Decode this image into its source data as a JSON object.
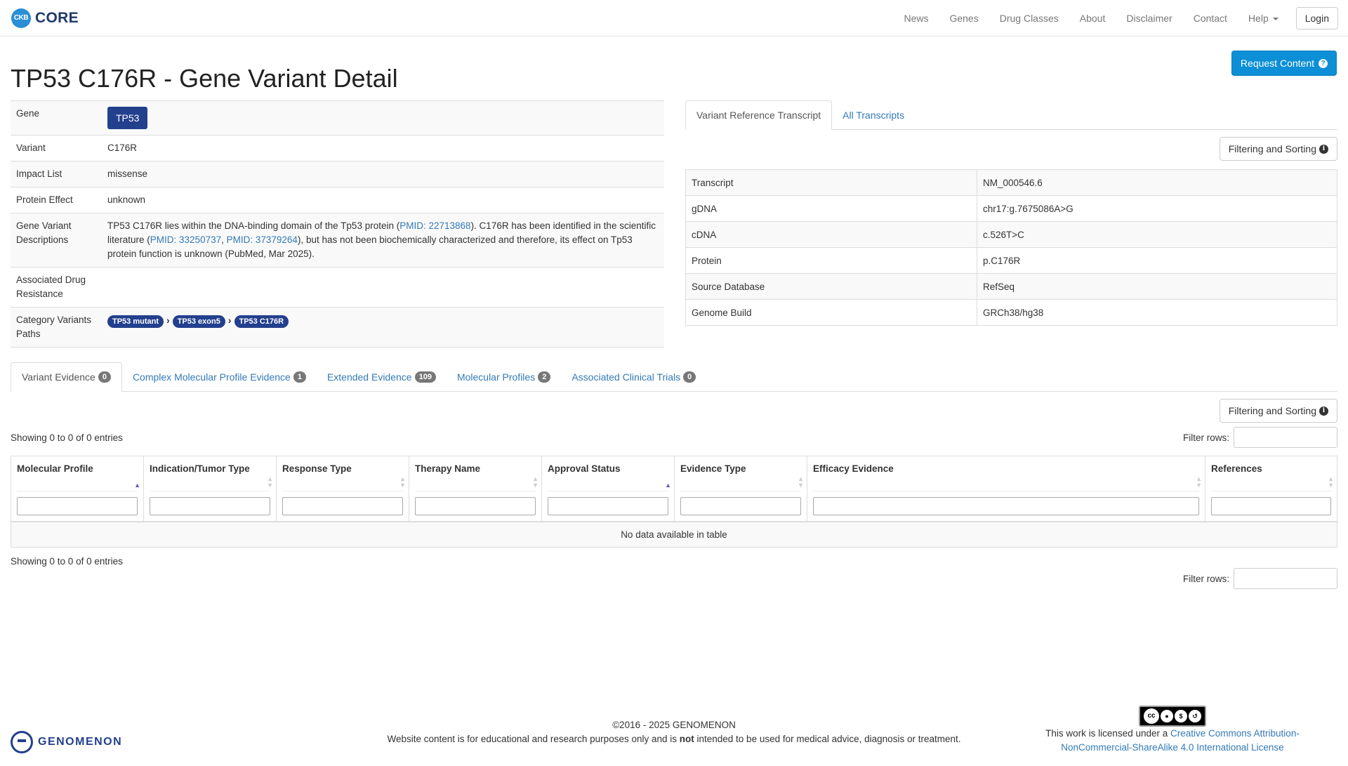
{
  "brand": {
    "logo_text": "CKB",
    "name": "CORE"
  },
  "nav": {
    "items": [
      "News",
      "Genes",
      "Drug Classes",
      "About",
      "Disclaimer",
      "Contact"
    ],
    "help": "Help",
    "login": "Login"
  },
  "header": {
    "title": "TP53 C176R - Gene Variant Detail",
    "request_button": "Request Content"
  },
  "detail": {
    "gene_label": "Gene",
    "gene_value": "TP53",
    "variant_label": "Variant",
    "variant_value": "C176R",
    "impact_label": "Impact List",
    "impact_value": "missense",
    "effect_label": "Protein Effect",
    "effect_value": "unknown",
    "desc_label": "Gene Variant Descriptions",
    "desc_part1": "TP53 C176R lies within the DNA-binding domain of the Tp53 protein (",
    "desc_link1": "PMID: 22713868",
    "desc_part2": "). C176R has been identified in the scientific literature (",
    "desc_link2": "PMID: 33250737",
    "desc_comma": ", ",
    "desc_link3": "PMID: 37379264",
    "desc_part3": "), but has not been biochemically characterized and therefore, its effect on Tp53 protein function is unknown (PubMed, Mar 2025).",
    "resistance_label": "Associated Drug Resistance",
    "paths_label": "Category Variants Paths",
    "paths": [
      "TP53 mutant",
      "TP53 exon5",
      "TP53 C176R"
    ]
  },
  "transcript": {
    "tabs": [
      "Variant Reference Transcript",
      "All Transcripts"
    ],
    "filter_button": "Filtering and Sorting",
    "rows": [
      {
        "label": "Transcript",
        "value": "NM_000546.6"
      },
      {
        "label": "gDNA",
        "value": "chr17:g.7675086A>G"
      },
      {
        "label": "cDNA",
        "value": "c.526T>C"
      },
      {
        "label": "Protein",
        "value": "p.C176R"
      },
      {
        "label": "Source Database",
        "value": "RefSeq"
      },
      {
        "label": "Genome Build",
        "value": "GRCh38/hg38"
      }
    ]
  },
  "evidence": {
    "tabs": [
      {
        "label": "Variant Evidence",
        "count": "0"
      },
      {
        "label": "Complex Molecular Profile Evidence",
        "count": "1"
      },
      {
        "label": "Extended Evidence",
        "count": "109"
      },
      {
        "label": "Molecular Profiles",
        "count": "2"
      },
      {
        "label": "Associated Clinical Trials",
        "count": "0"
      }
    ],
    "filter_button": "Filtering and Sorting",
    "showing": "Showing 0 to 0 of 0 entries",
    "filter_rows": "Filter rows:",
    "columns": [
      "Molecular Profile",
      "Indication/Tumor Type",
      "Response Type",
      "Therapy Name",
      "Approval Status",
      "Evidence Type",
      "Efficacy Evidence",
      "References"
    ],
    "empty": "No data available in table"
  },
  "footer": {
    "copyright": "©2016 - 2025 GENOMENON",
    "disclaimer_part1": "Website content is for educational and research purposes only and is ",
    "disclaimer_bold": "not",
    "disclaimer_part2": " intended to be used for medical advice, diagnosis or treatment.",
    "company": "GENOMENON",
    "license_prefix": "This work is licensed under a ",
    "license_link": "Creative Commons Attribution-NonCommercial-ShareAlike 4.0 International License"
  }
}
